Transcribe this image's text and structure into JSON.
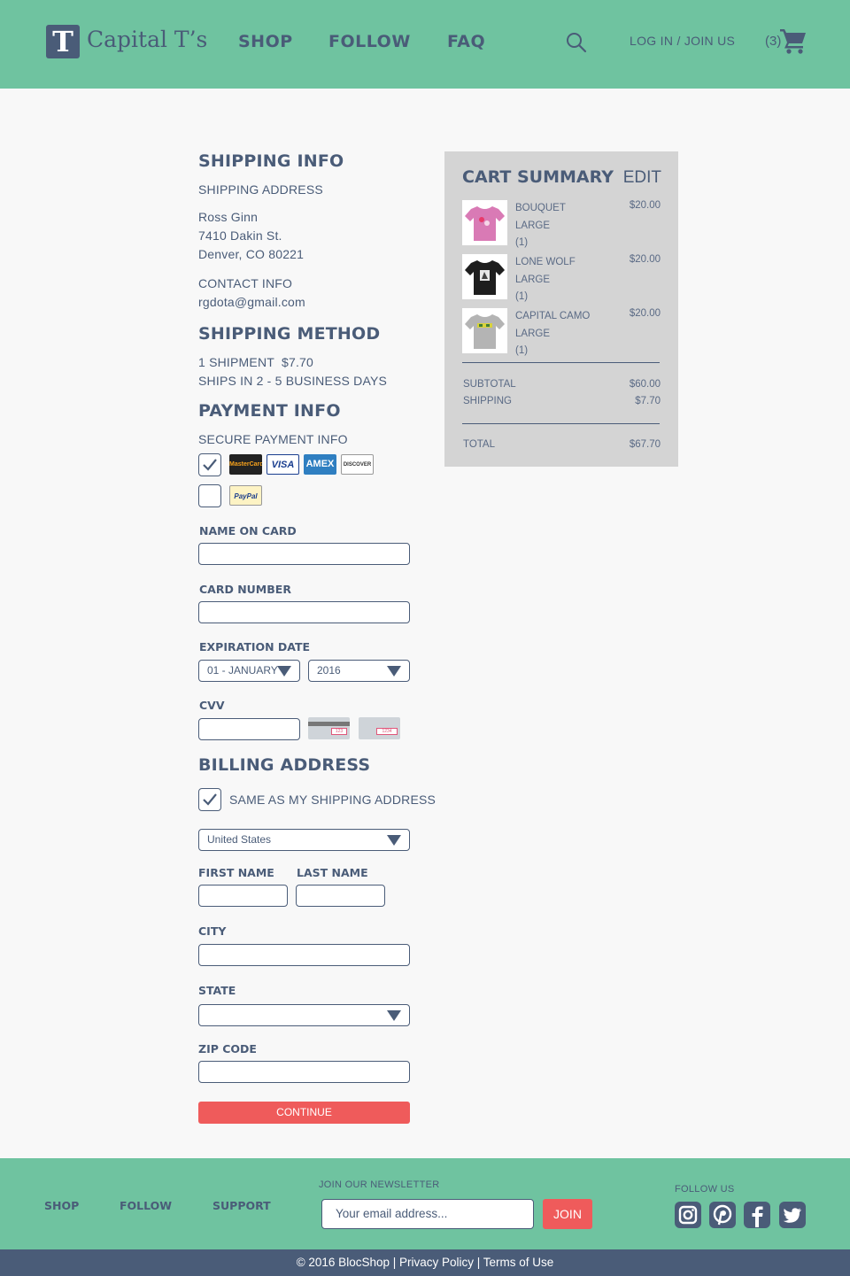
{
  "header": {
    "logo_letter": "T",
    "logo_text": "Capital T’s",
    "nav": [
      "SHOP",
      "FOLLOW",
      "FAQ"
    ],
    "login": "LOG IN / JOIN US",
    "cart_count": "(3)"
  },
  "shipping_info": {
    "title": "SHIPPING INFO",
    "address_label": "SHIPPING ADDRESS",
    "name": "Ross Ginn",
    "street": "7410 Dakin St.",
    "city_line": "Denver, CO 80221",
    "contact_label": "CONTACT INFO",
    "email": "rgdota@gmail.com"
  },
  "shipping_method": {
    "title": "SHIPPING METHOD",
    "shipment": "1 SHIPMENT",
    "price": "$7.70",
    "eta": "SHIPS IN 2 - 5 BUSINESS DAYS"
  },
  "payment": {
    "title": "PAYMENT INFO",
    "secure_label": "SECURE PAYMENT INFO",
    "card_logos": [
      "MasterCard",
      "VISA",
      "AMEX",
      "DISCOVER"
    ],
    "paypal": "PayPal",
    "name_on_card_label": "NAME ON CARD",
    "card_number_label": "CARD NUMBER",
    "expiration_label": "EXPIRATION DATE",
    "exp_month": "01 - JANUARY",
    "exp_year": "2016",
    "cvv_label": "CVV",
    "cvv_sample_3": "123",
    "cvv_sample_4": "1234"
  },
  "billing": {
    "title": "BILLING ADDRESS",
    "same_as_label": "SAME AS MY SHIPPING ADDRESS",
    "country": "United States",
    "first_name_label": "FIRST NAME",
    "last_name_label": "LAST NAME",
    "city_label": "CITY",
    "state_label": "STATE",
    "zip_label": "ZIP CODE",
    "continue": "CONTINUE"
  },
  "cart": {
    "title": "CART SUMMARY",
    "edit": "EDIT",
    "items": [
      {
        "name": "BOUQUET",
        "size": "LARGE",
        "qty": "(1)",
        "price": "$20.00",
        "color": "#d97ab5"
      },
      {
        "name": "LONE WOLF",
        "size": "LARGE",
        "qty": "(1)",
        "price": "$20.00",
        "color": "#1e1e1e"
      },
      {
        "name": "CAPITAL CAMO",
        "size": "LARGE",
        "qty": "(1)",
        "price": "$20.00",
        "color": "#b4b4b4"
      }
    ],
    "subtotal_label": "SUBTOTAL",
    "subtotal": "$60.00",
    "shipping_label": "SHIPPING",
    "shipping": "$7.70",
    "total_label": "TOTAL",
    "total": "$67.70"
  },
  "footer": {
    "nav": [
      "SHOP",
      "FOLLOW",
      "SUPPORT"
    ],
    "newsletter_label": "JOIN OUR NEWSLETTER",
    "email_placeholder": "Your email address...",
    "join": "JOIN",
    "follow_label": "FOLLOW US",
    "social": [
      "instagram-icon",
      "pinterest-icon",
      "facebook-icon",
      "twitter-icon"
    ],
    "copyright": "© 2016 BlocShop |  Privacy Policy  |  Terms of Use"
  },
  "colors": {
    "brand_green": "#6fc3a0",
    "navy": "#4a5c78",
    "accent_red": "#ef5b5b"
  }
}
